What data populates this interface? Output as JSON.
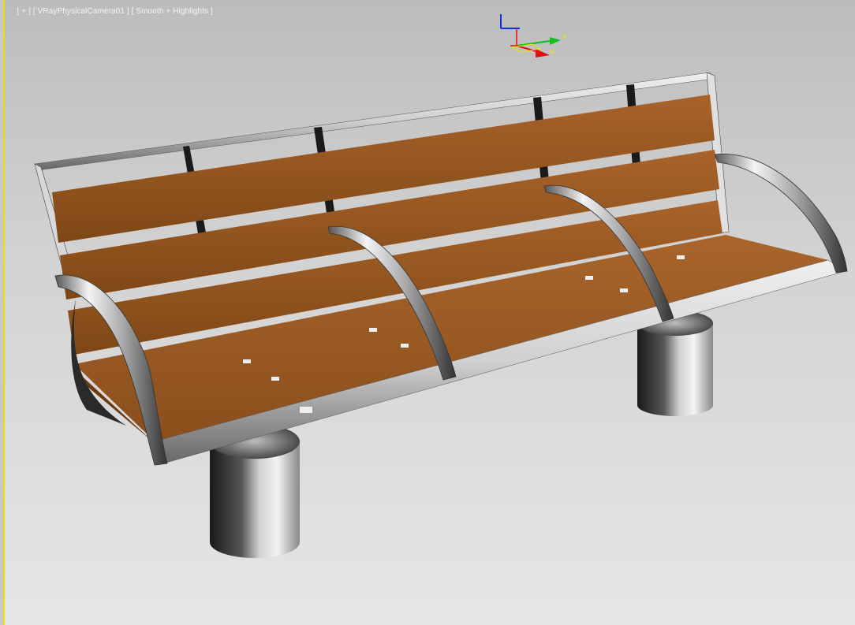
{
  "viewport": {
    "menu_plus": "[ + ]",
    "camera_label": "[ VRayPhysicalCamera01 ]",
    "shading_label": "[ Smooth + Highlights ]",
    "active_border_color": "#e8e000",
    "background_color": "#cfcfcf"
  },
  "gizmo": {
    "x_label": "x",
    "y_label": "y",
    "z_label": "z",
    "x_color": "#e01010",
    "y_color": "#10c020",
    "z_color": "#1030e0"
  },
  "scene": {
    "object": "bench-model",
    "wood_color": "#9a5a22",
    "metal_color": "#e6e6e6"
  }
}
